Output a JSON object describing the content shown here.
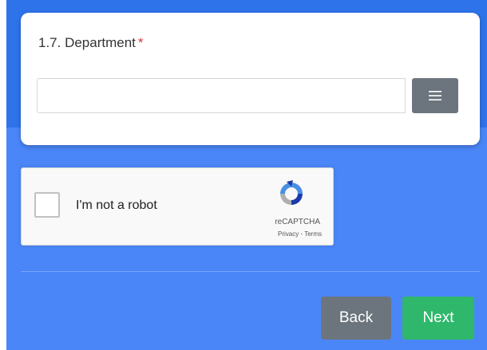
{
  "form": {
    "department_label": "1.7. Department",
    "required_marker": "*",
    "department_value": "",
    "list_icon": "list-icon"
  },
  "recaptcha": {
    "checkbox_label": "I'm not a robot",
    "brand": "reCAPTCHA",
    "privacy": "Privacy",
    "separator": " - ",
    "terms": "Terms"
  },
  "nav": {
    "back_label": "Back",
    "next_label": "Next"
  },
  "colors": {
    "background": "#4a86f7",
    "back_button": "#6c757d",
    "next_button": "#2fb86b",
    "required": "#dc3545"
  }
}
